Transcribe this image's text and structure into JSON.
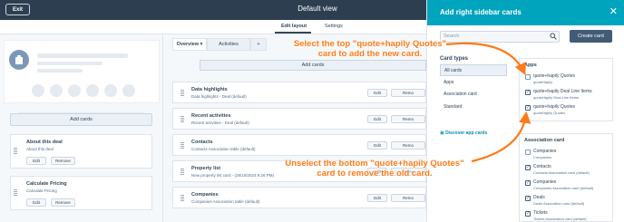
{
  "topbar": {
    "exit_label": "Exit",
    "title": "Default view"
  },
  "tabs": {
    "edit_layout": "Edit layout",
    "settings": "Settings"
  },
  "left": {
    "avatar_icon": "company-icon",
    "add_cards_label": "Add cards",
    "cards": [
      {
        "title": "About this deal",
        "subtitle": "About this deal",
        "edit": "Edit",
        "remove": "Remove"
      },
      {
        "title": "Calculate Pricing",
        "subtitle": "Calculate Pricing",
        "edit": "Edit",
        "remove": "Remove"
      }
    ]
  },
  "center": {
    "tabs": [
      {
        "label": "Overview"
      },
      {
        "label": "Activities"
      },
      {
        "label": "+"
      }
    ],
    "add_cards_label": "Add cards",
    "cards": [
      {
        "title": "Data highlights",
        "subtitle": "Data highlights - Deal (default)",
        "edit": "Edit",
        "remove": "Remo"
      },
      {
        "title": "Recent activities",
        "subtitle": "Recent activities - Deal (default)",
        "edit": "Edit",
        "remove": "Remo"
      },
      {
        "title": "Contacts",
        "subtitle": "Contacts Association table (default)",
        "edit": "Edit",
        "remove": "Remo"
      },
      {
        "title": "Property list",
        "subtitle": "New property list card - (28/10/2024 9:26 PM)",
        "edit": "Edit",
        "remove": "Remo"
      },
      {
        "title": "Companies",
        "subtitle": "Companies Association table (default)",
        "edit": "Edit",
        "remove": "Remo"
      }
    ]
  },
  "panel": {
    "title": "Add right sidebar cards",
    "search_placeholder": "Search",
    "create_label": "Create card",
    "card_types_label": "Card types",
    "card_types": [
      "All cards",
      "Apps",
      "Association card",
      "Standard"
    ],
    "discover_label": "Discover app cards",
    "apps_label": "Apps",
    "apps": [
      {
        "name": "quote+hapily Quotes",
        "sub": "quoteHapily",
        "checked": false
      },
      {
        "name": "quote+hapily Deal Line Items",
        "sub": "quoteHapily Deal Line Items",
        "checked": true
      },
      {
        "name": "quote+hapily Quotes",
        "sub": "quoteHapily Quotes",
        "checked": true
      }
    ],
    "assoc_label": "Association card",
    "assoc": [
      {
        "name": "Companies",
        "sub": "Companies",
        "checked": false
      },
      {
        "name": "Contacts",
        "sub": "Contacts Association card (default)",
        "checked": true
      },
      {
        "name": "Companies",
        "sub": "Companies Association card (default)",
        "checked": true
      },
      {
        "name": "Deals",
        "sub": "Deals Association card (default)",
        "checked": true
      },
      {
        "name": "Tickets",
        "sub": "Tickets Association card (default)",
        "checked": true
      }
    ]
  },
  "annotations": {
    "top": "Select the top \"quote+hapily Quotes\"\ncard to add the new card.",
    "bottom": "Unselect the bottom \"quote+hapily Quotes\"\ncard to remove the old card."
  },
  "colors": {
    "accent": "#00a4bd",
    "annotation": "#ff7a18",
    "topbar": "#2d3e50"
  }
}
